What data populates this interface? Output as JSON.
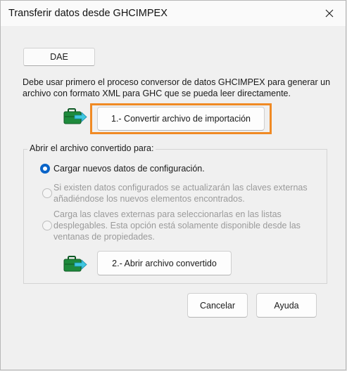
{
  "window": {
    "title": "Transferir datos desde GHCIMPEX",
    "close_icon": "close-icon"
  },
  "tabs": [
    {
      "label": "DAE",
      "selected": true
    }
  ],
  "description": {
    "line1": "Debe usar primero el proceso conversor de datos GHCIMPEX para generar un",
    "line2": "archivo con formato XML para GHC que se pueda leer directamente."
  },
  "convert": {
    "icon": "briefcase-arrow-icon",
    "button_label": "1.- Convertir archivo de importación",
    "highlight_color": "#f08a24"
  },
  "open_group": {
    "label": "Abrir el archivo convertido para:",
    "options": [
      {
        "label": "Cargar nuevos datos de configuración.",
        "selected": true,
        "enabled": true
      },
      {
        "line1": "Si existen datos configurados se actualizarán las claves externas",
        "line2": "añadiéndose los nuevos elementos encontrados.",
        "selected": false,
        "enabled": false
      },
      {
        "line1": "Carga las claves externas para seleccionarlas en las listas",
        "line2": "desplegables. Esta opción está solamente disponible desde las",
        "line3": "ventanas de propiedades.",
        "selected": false,
        "enabled": false
      }
    ],
    "open_icon": "briefcase-arrow-icon",
    "open_button_label": "2.- Abrir archivo convertido"
  },
  "footer": {
    "cancel_label": "Cancelar",
    "help_label": "Ayuda"
  },
  "colors": {
    "accent": "#0a64c8",
    "briefcase": "#1e8a3c",
    "arrow": "#3fc7e0"
  }
}
